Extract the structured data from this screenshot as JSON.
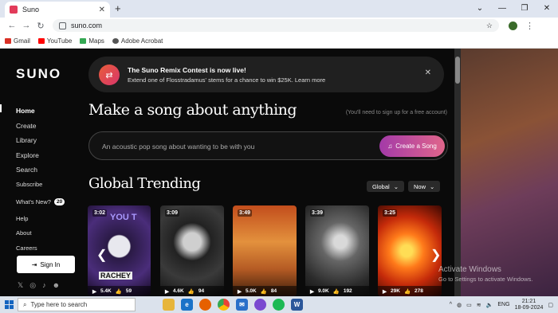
{
  "browser": {
    "tab_title": "Suno",
    "url": "suno.com",
    "bookmarks": [
      "Gmail",
      "YouTube",
      "Maps",
      "Adobe Acrobat"
    ]
  },
  "sidebar": {
    "logo": "SUNO",
    "items": [
      {
        "label": "Home"
      },
      {
        "label": "Create"
      },
      {
        "label": "Library"
      },
      {
        "label": "Explore"
      },
      {
        "label": "Search"
      },
      {
        "label": "Subscribe"
      },
      {
        "label": "What's New?",
        "badge": "20"
      },
      {
        "label": "Help"
      },
      {
        "label": "About"
      },
      {
        "label": "Careers"
      }
    ],
    "signin_label": "Sign In"
  },
  "banner": {
    "title": "The Suno Remix Contest is now live!",
    "text": "Extend one of Flosstradamus' stems for a chance to win $25K. Learn more"
  },
  "hero": {
    "headline": "Make a song about anything",
    "hint": "(You'll need to sign up for a free account)",
    "placeholder": "An acoustic pop song about wanting to be with you",
    "create_label": "Create a Song"
  },
  "trending": {
    "title": "Global Trending",
    "filter_region": "Global",
    "filter_time": "Now",
    "cards": [
      {
        "duration": "3:02",
        "plays": "5.4K",
        "likes": "59",
        "label": "RACHEY",
        "overlay": "YOU T"
      },
      {
        "duration": "3:09",
        "plays": "4.6K",
        "likes": "94"
      },
      {
        "duration": "3:49",
        "plays": "5.0K",
        "likes": "84"
      },
      {
        "duration": "3:39",
        "plays": "9.0K",
        "likes": "192"
      },
      {
        "duration": "3:25",
        "plays": "29K",
        "likes": "278"
      }
    ]
  },
  "watermark": {
    "line1": "Activate Windows",
    "line2": "Go to Settings to activate Windows."
  },
  "taskbar": {
    "search_placeholder": "Type here to search",
    "language": "ENG",
    "time": "21:21",
    "date": "18-09-2024"
  }
}
